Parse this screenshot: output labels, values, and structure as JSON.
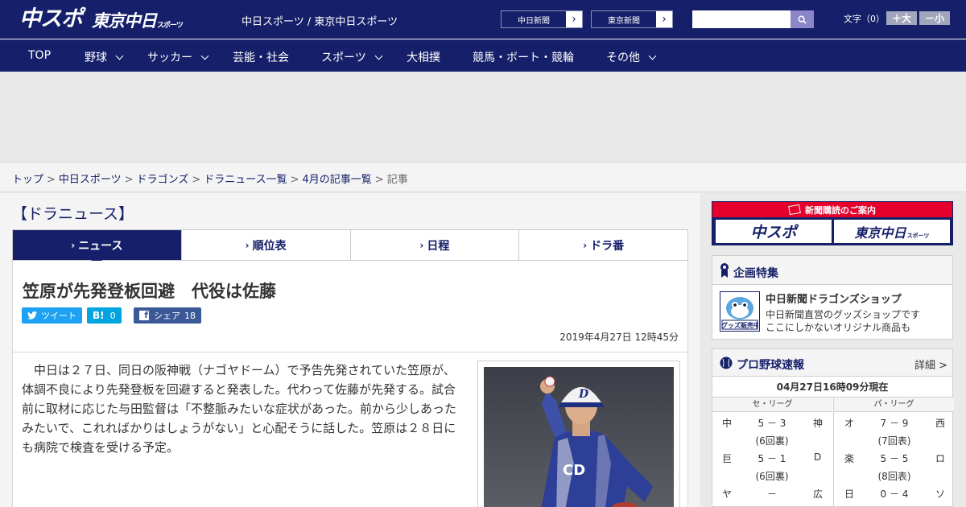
{
  "header": {
    "logo_main": "中スポ",
    "logo_sub": "東京中日",
    "logo_sub_small": "スポーツ",
    "site_links": "中日スポーツ / 東京中日スポーツ",
    "paper_buttons": [
      "中日新聞",
      "東京新聞"
    ],
    "search": {
      "value": "",
      "placeholder": ""
    },
    "font_size_label": "文字（0）",
    "font_larger": "＋大",
    "font_smaller": "－小"
  },
  "nav": {
    "items": [
      {
        "label": "TOP",
        "has_dropdown": false
      },
      {
        "label": "野球",
        "has_dropdown": true
      },
      {
        "label": "サッカー",
        "has_dropdown": true
      },
      {
        "label": "芸能・社会",
        "has_dropdown": false
      },
      {
        "label": "スポーツ",
        "has_dropdown": true
      },
      {
        "label": "大相撲",
        "has_dropdown": false
      },
      {
        "label": "競馬・ボート・競輪",
        "has_dropdown": false
      },
      {
        "label": "その他",
        "has_dropdown": true
      }
    ]
  },
  "breadcrumb": {
    "items": [
      "トップ",
      "中日スポーツ",
      "ドラゴンズ",
      "ドラニュース一覧",
      "4月の記事一覧"
    ],
    "current": "記事",
    "separator": ">"
  },
  "section_title": "【ドラニュース】",
  "tabs": {
    "items": [
      "ニュース",
      "順位表",
      "日程",
      "ドラ番"
    ],
    "active": "ニュース"
  },
  "article": {
    "headline": "笠原が先発登板回避　代役は佐藤",
    "share": {
      "tweet": "ツイート",
      "hatena_label": "B!",
      "hatena_count": "0",
      "facebook_label": "シェア",
      "facebook_count": "18"
    },
    "date": "2019年4月27日 12時45分",
    "body": "　中日は２７日、同日の阪神戦（ナゴヤドーム）で予告先発されていた笠原が、体調不良により先発登板を回避すると発表した。代わって佐藤が先発する。試合前に取材に応じた与田監督は「不整脈みたいな症状があった。前から少しあったみたいで、これればかりはしょうがない」と心配そうに話した。笠原は２８日にも病院で検査を受ける予定。"
  },
  "sidebar": {
    "subscribe": {
      "header": "新聞購読のご案内",
      "logo_chunichi": "中スポ",
      "logo_tokyo": "東京中日",
      "logo_tokyo_small": "スポーツ"
    },
    "special": {
      "title": "企画特集",
      "thumb_label": "グッズ販売中",
      "shop_title": "中日新聞ドラゴンズショップ",
      "shop_desc1": "中日新聞直営のグッズショップです",
      "shop_desc2": "ここにしかないオリジナル商品も"
    },
    "scores": {
      "title": "プロ野球速報",
      "more": "詳細 >",
      "updated": "04月27日16時09分現在",
      "central_label": "セ・リーグ",
      "pacific_label": "パ・リーグ",
      "central": [
        {
          "home": "中",
          "score": "5 － 3",
          "away": "神",
          "status": "(6回裏)"
        },
        {
          "home": "巨",
          "score": "5 － 1",
          "away": "D",
          "status": "(6回裏)"
        },
        {
          "home": "ヤ",
          "score": "－",
          "away": "広",
          "status": ""
        }
      ],
      "pacific": [
        {
          "home": "オ",
          "score": "7 － 9",
          "away": "西",
          "status": "(7回表)"
        },
        {
          "home": "楽",
          "score": "5 － 5",
          "away": "ロ",
          "status": "(8回表)"
        },
        {
          "home": "日",
          "score": "0 － 4",
          "away": "ソ",
          "status": ""
        }
      ]
    }
  },
  "colors": {
    "brand_navy": "#16206a",
    "accent_red": "#e4002b",
    "twitter": "#1da1f2",
    "hatena": "#00a4de",
    "facebook": "#3b5998"
  }
}
